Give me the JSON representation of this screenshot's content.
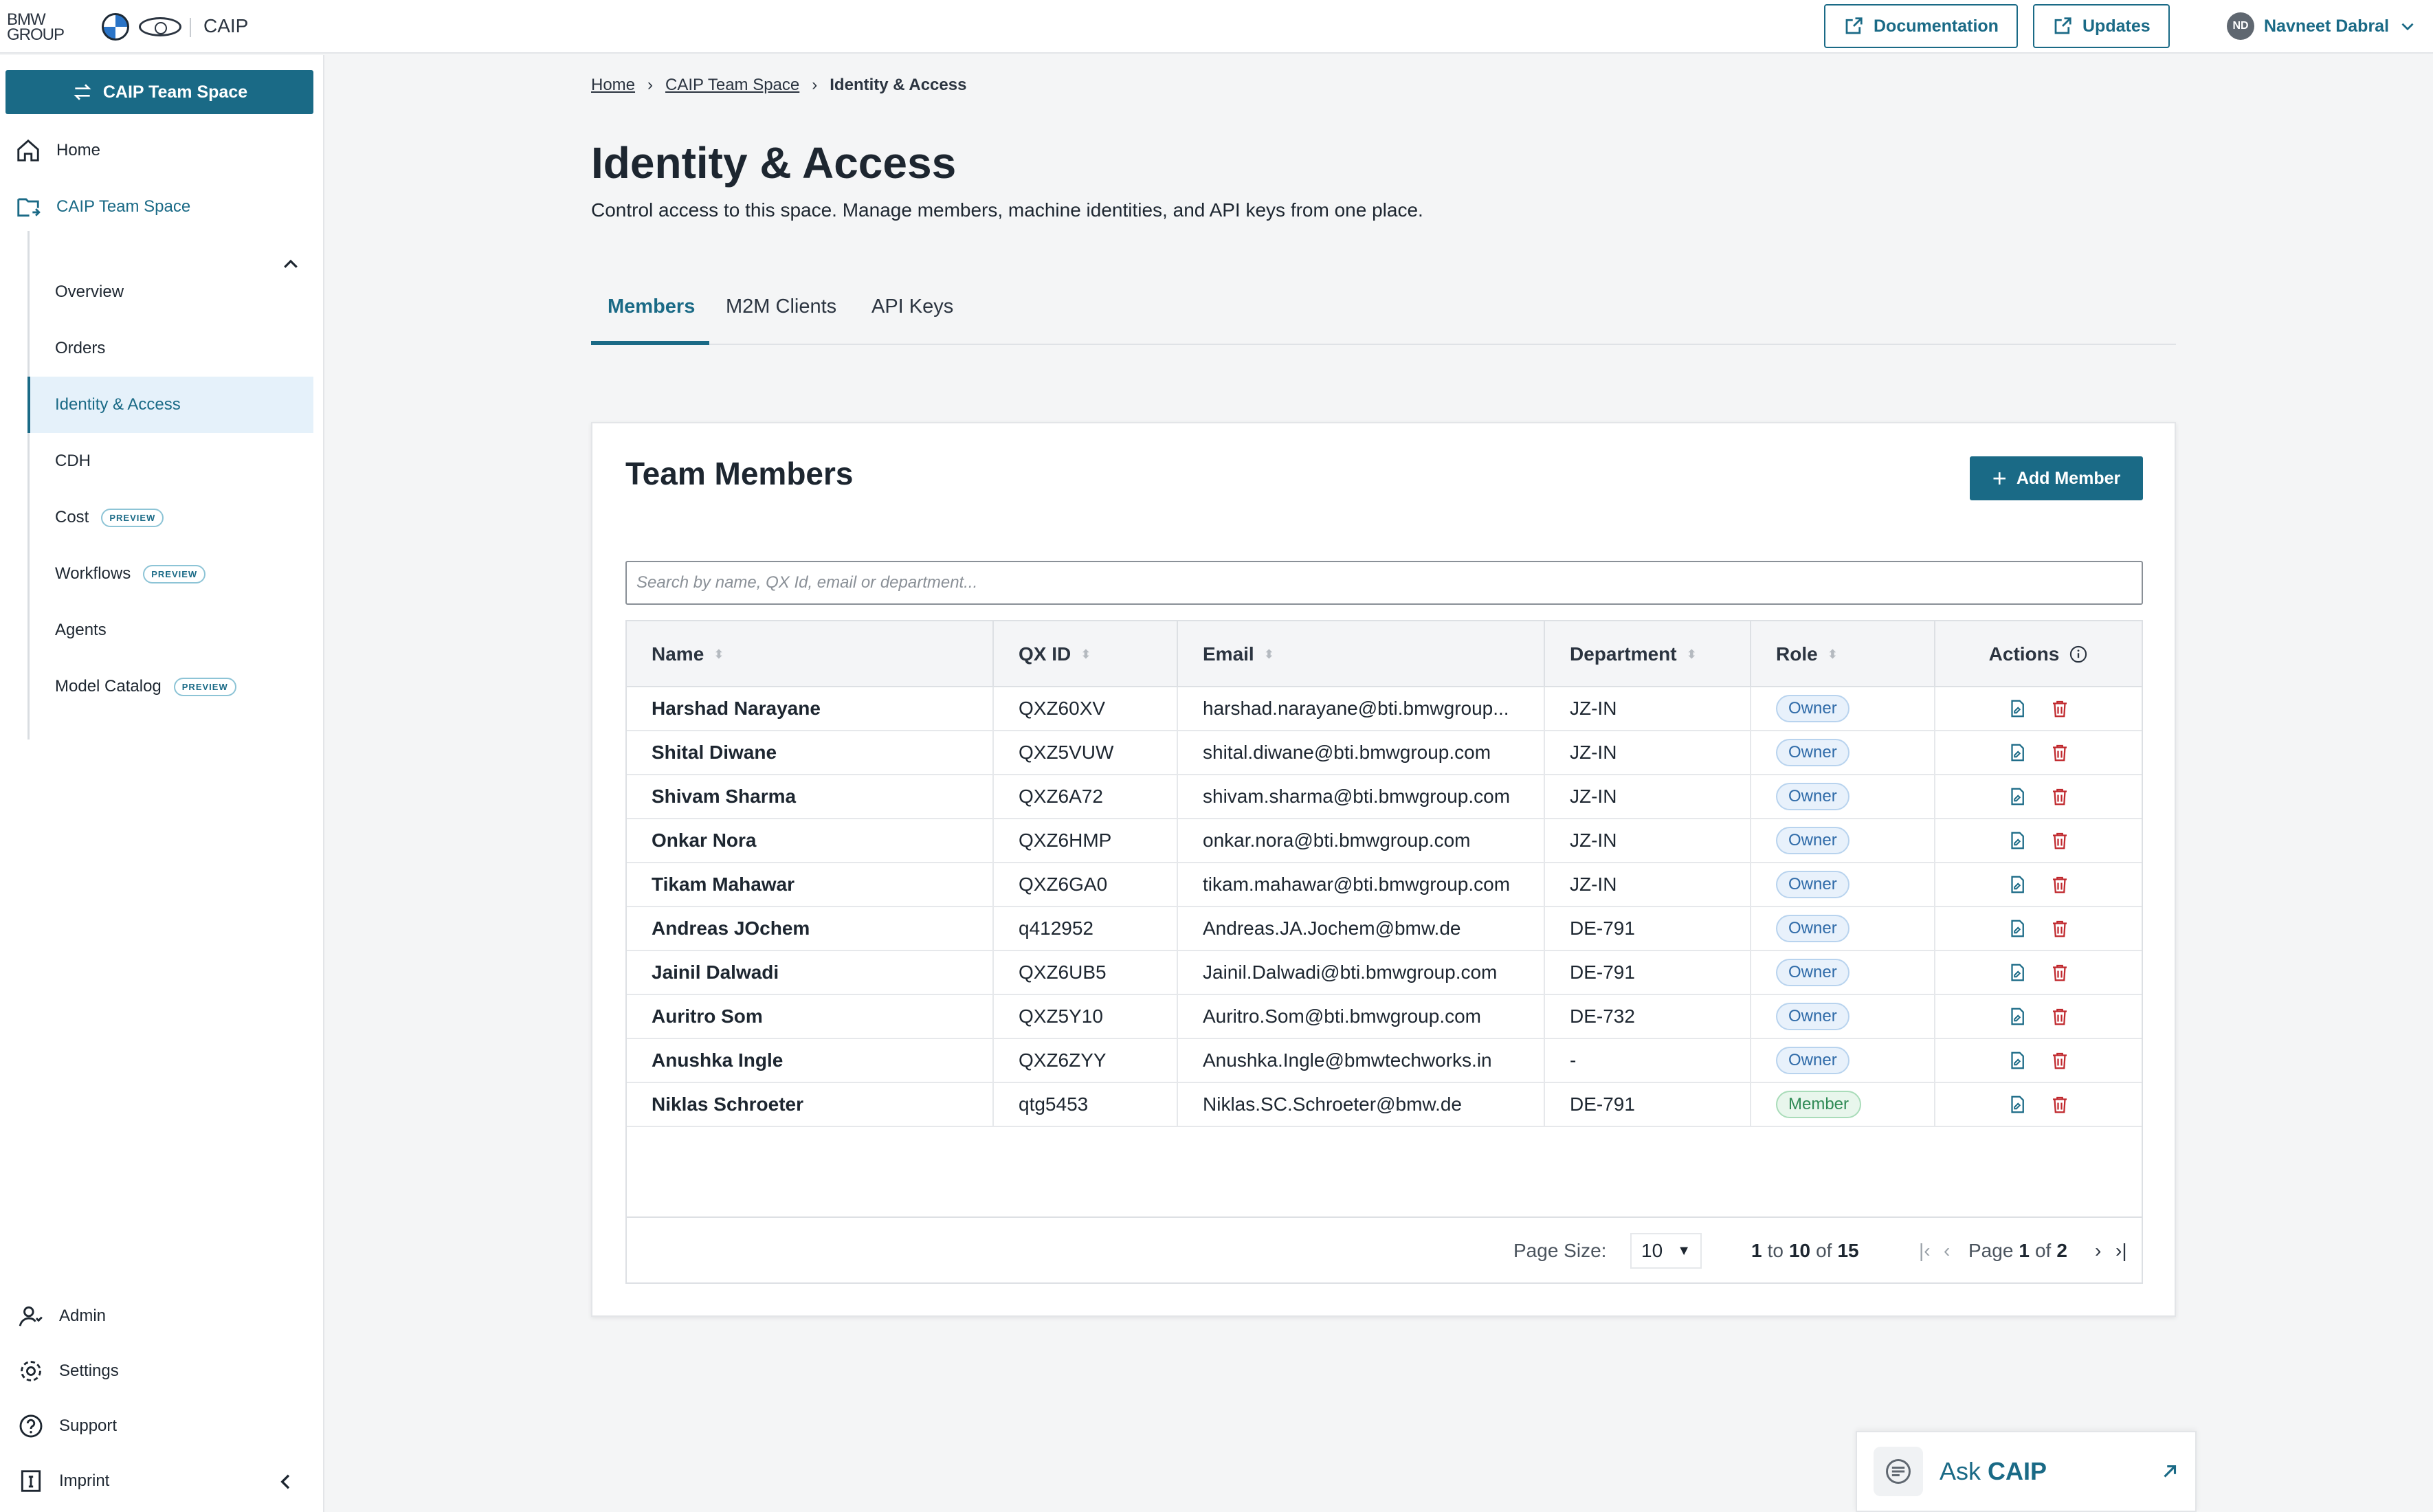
{
  "header": {
    "brand_line1": "BMW",
    "brand_line2": "GROUP",
    "app_name": "CAIP",
    "documentation_label": "Documentation",
    "updates_label": "Updates",
    "user_initials": "ND",
    "user_name": "Navneet Dabral"
  },
  "sidebar": {
    "team_button": "CAIP Team Space",
    "home": "Home",
    "team_space": "CAIP Team Space",
    "sub_items": [
      {
        "label": "Overview"
      },
      {
        "label": "Orders"
      },
      {
        "label": "Identity & Access"
      },
      {
        "label": "CDH"
      },
      {
        "label": "Cost",
        "badge": "PREVIEW"
      },
      {
        "label": "Workflows",
        "badge": "PREVIEW"
      },
      {
        "label": "Agents"
      },
      {
        "label": "Model Catalog",
        "badge": "PREVIEW"
      }
    ],
    "bottom": {
      "admin": "Admin",
      "settings": "Settings",
      "support": "Support",
      "imprint": "Imprint"
    }
  },
  "breadcrumb": {
    "home": "Home",
    "team_space": "CAIP Team Space",
    "current": "Identity & Access"
  },
  "page": {
    "title": "Identity & Access",
    "description": "Control access to this space. Manage members, machine identities, and API keys from one place."
  },
  "tabs": [
    {
      "label": "Members"
    },
    {
      "label": "M2M Clients"
    },
    {
      "label": "API Keys"
    }
  ],
  "card": {
    "title": "Team Members",
    "add_button": "Add Member",
    "search_placeholder": "Search by name, QX Id, email or department..."
  },
  "table": {
    "columns": [
      "Name",
      "QX ID",
      "Email",
      "Department",
      "Role",
      "Actions"
    ],
    "rows": [
      {
        "name": "Harshad Narayane",
        "qx": "QXZ60XV",
        "email": "harshad.narayane@bti.bmwgroup...",
        "dept": "JZ-IN",
        "role": "Owner"
      },
      {
        "name": "Shital Diwane",
        "qx": "QXZ5VUW",
        "email": "shital.diwane@bti.bmwgroup.com",
        "dept": "JZ-IN",
        "role": "Owner"
      },
      {
        "name": "Shivam Sharma",
        "qx": "QXZ6A72",
        "email": "shivam.sharma@bti.bmwgroup.com",
        "dept": "JZ-IN",
        "role": "Owner"
      },
      {
        "name": "Onkar Nora",
        "qx": "QXZ6HMP",
        "email": "onkar.nora@bti.bmwgroup.com",
        "dept": "JZ-IN",
        "role": "Owner"
      },
      {
        "name": "Tikam Mahawar",
        "qx": "QXZ6GA0",
        "email": "tikam.mahawar@bti.bmwgroup.com",
        "dept": "JZ-IN",
        "role": "Owner"
      },
      {
        "name": "Andreas JOchem",
        "qx": "q412952",
        "email": "Andreas.JA.Jochem@bmw.de",
        "dept": "DE-791",
        "role": "Owner"
      },
      {
        "name": "Jainil Dalwadi",
        "qx": "QXZ6UB5",
        "email": "Jainil.Dalwadi@bti.bmwgroup.com",
        "dept": "DE-791",
        "role": "Owner"
      },
      {
        "name": "Auritro Som",
        "qx": "QXZ5Y10",
        "email": "Auritro.Som@bti.bmwgroup.com",
        "dept": "DE-732",
        "role": "Owner"
      },
      {
        "name": "Anushka Ingle",
        "qx": "QXZ6ZYY",
        "email": "Anushka.Ingle@bmwtechworks.in",
        "dept": "-",
        "role": "Owner"
      },
      {
        "name": "Niklas Schroeter",
        "qx": "qtg5453",
        "email": "Niklas.SC.Schroeter@bmw.de",
        "dept": "DE-791",
        "role": "Member"
      }
    ]
  },
  "pagination": {
    "page_size_label": "Page Size:",
    "page_size": "10",
    "range_from": "1",
    "range_to": "10",
    "range_total": "15",
    "to_word": "to",
    "of_word": "of",
    "page_word": "Page",
    "page_current": "1",
    "page_total": "2"
  },
  "ask": {
    "prefix": "Ask",
    "name": "CAIP"
  },
  "colors": {
    "accent": "#1a6a86",
    "delete": "#c0282d",
    "owner": "#2e6aa8",
    "member": "#2f8a55"
  }
}
